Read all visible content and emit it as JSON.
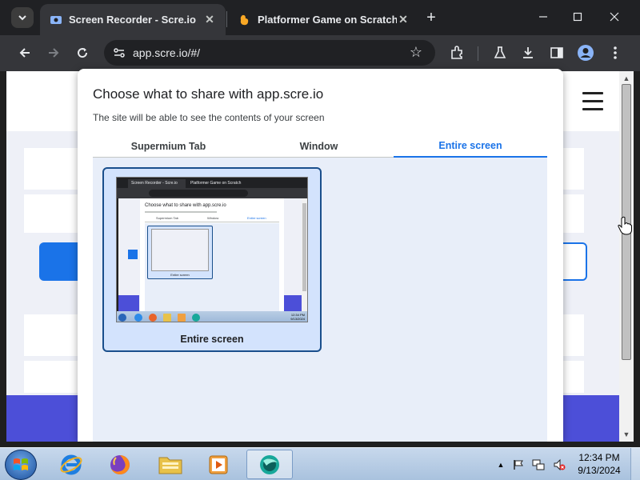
{
  "browser": {
    "tabs": [
      {
        "title": "Screen Recorder - Scre.io",
        "active": true
      },
      {
        "title": "Platformer Game on Scratch",
        "active": false
      }
    ],
    "url": "app.scre.io/#/",
    "accent_color": "#1a73e8"
  },
  "dialog": {
    "title": "Choose what to share with app.scre.io",
    "subtitle": "The site will be able to see the contents of your screen",
    "tabs": [
      "Supermium Tab",
      "Window",
      "Entire screen"
    ],
    "selected_tab": "Entire screen",
    "source_label": "Entire screen"
  },
  "thumbnail": {
    "tabs": [
      "Screen Recorder - Scre.io",
      "Platformer Game on Scratch"
    ],
    "dialog_title": "Choose what to share with app.scre.io",
    "dialog_tabs": [
      "Supermium Tab",
      "Window",
      "Entire screen"
    ],
    "tile_label": "Entire screen",
    "clock_time": "12:34 PM",
    "clock_date": "9/13/2024"
  },
  "taskbar": {
    "apps": [
      "internet-explorer",
      "firefox",
      "file-explorer",
      "media-player",
      "screen-recorder"
    ],
    "time": "12:34 PM",
    "date": "9/13/2024"
  }
}
